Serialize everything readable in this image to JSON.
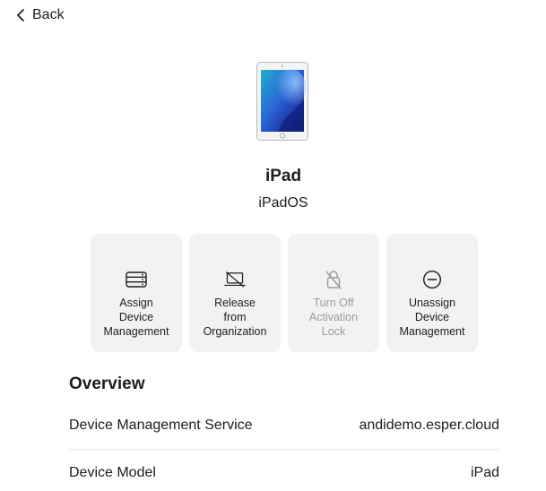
{
  "nav": {
    "back_label": "Back"
  },
  "device": {
    "name": "iPad",
    "os": "iPadOS"
  },
  "actions": [
    {
      "label_lines": [
        "Assign",
        "Device",
        "Management"
      ],
      "icon": "server-stack-icon",
      "enabled": true
    },
    {
      "label_lines": [
        "Release",
        "from",
        "Organization"
      ],
      "icon": "laptop-off-icon",
      "enabled": true
    },
    {
      "label_lines": [
        "Turn Off",
        "Activation",
        "Lock"
      ],
      "icon": "lock-off-icon",
      "enabled": false
    },
    {
      "label_lines": [
        "Unassign",
        "Device",
        "Management"
      ],
      "icon": "minus-circle-icon",
      "enabled": true
    }
  ],
  "overview": {
    "title": "Overview",
    "rows": [
      {
        "label": "Device Management Service",
        "value": "andidemo.esper.cloud"
      },
      {
        "label": "Device Model",
        "value": "iPad"
      }
    ]
  },
  "colors": {
    "tile_background": "#f2f2f4",
    "disabled_text": "#9a9a9f",
    "divider": "#e2e2e6"
  }
}
